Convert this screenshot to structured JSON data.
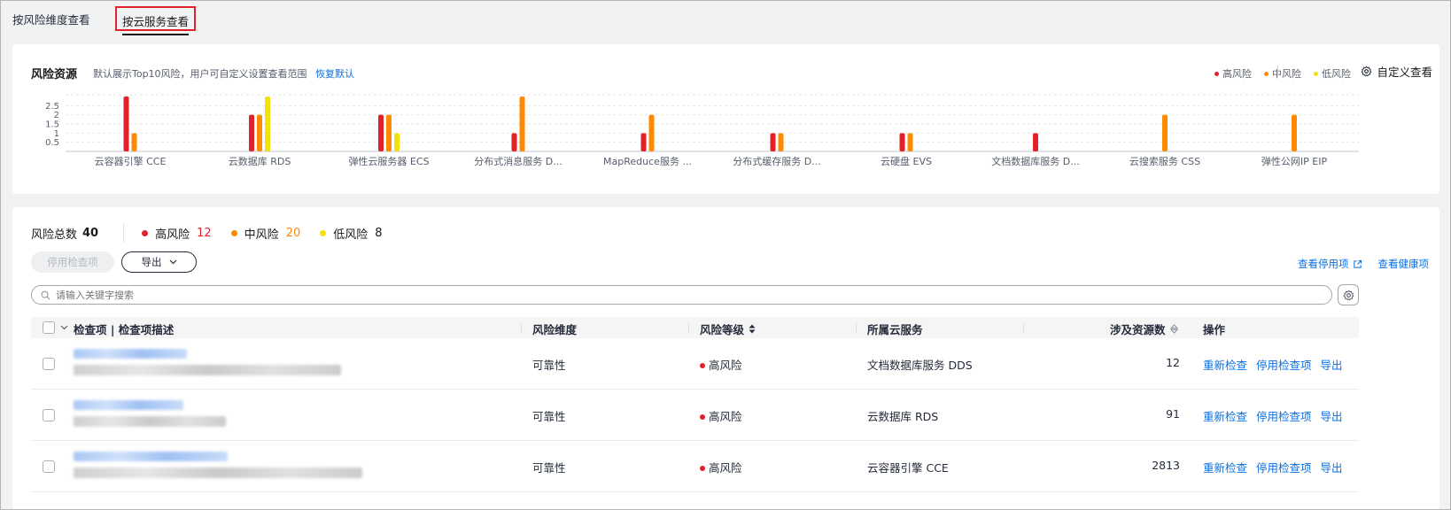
{
  "tabs": [
    {
      "label": "按风险维度查看"
    },
    {
      "label": "按云服务查看"
    }
  ],
  "risk_card": {
    "title": "风险资源",
    "subtitle": "默认展示Top10风险，用户可自定义设置查看范围",
    "restore_label": "恢复默认",
    "legend": [
      {
        "label": "高风险",
        "color": "#e1222b"
      },
      {
        "label": "中风险",
        "color": "#ff8a00"
      },
      {
        "label": "低风险",
        "color": "#f2e10c"
      }
    ],
    "custom_view_label": "自定义查看"
  },
  "chart_data": {
    "type": "bar",
    "categories": [
      "云容器引擎 CCE",
      "云数据库 RDS",
      "弹性云服务器 ECS",
      "分布式消息服务 D...",
      "MapReduce服务 ...",
      "分布式缓存服务 D...",
      "云硬盘 EVS",
      "文档数据库服务 D...",
      "云搜索服务 CSS",
      "弹性公网IP EIP"
    ],
    "series": [
      {
        "name": "高风险",
        "color": "#e1222b",
        "values": [
          3,
          2,
          2,
          1,
          1,
          1,
          1,
          1,
          0,
          0
        ]
      },
      {
        "name": "中风险",
        "color": "#ff8a00",
        "values": [
          1,
          2,
          2,
          3,
          2,
          1,
          1,
          0,
          2,
          2
        ]
      },
      {
        "name": "低风险",
        "color": "#f2e10c",
        "values": [
          0,
          3,
          1,
          0,
          0,
          0,
          0,
          0,
          0,
          0
        ]
      }
    ],
    "y_ticks": [
      "2.5",
      "2",
      "1.5",
      "1",
      "0.5"
    ],
    "ylim": [
      0,
      3
    ],
    "grid": true
  },
  "summary": {
    "total_label": "风险总数",
    "total": "40",
    "high_label": "高风险",
    "high": "12",
    "high_color": "#e1222b",
    "mid_label": "中风险",
    "mid": "20",
    "mid_color": "#ff8a00",
    "low_label": "低风险",
    "low": "8",
    "low_color": "#f2e10c"
  },
  "toolbar": {
    "disable_label": "停用检查项",
    "export_label": "导出",
    "view_disabled_label": "查看停用项",
    "view_healthy_label": "查看健康项"
  },
  "search": {
    "placeholder": "请输入关键字搜索"
  },
  "table": {
    "headers": {
      "item": "检查项 | 检查项描述",
      "dimension": "风险维度",
      "level": "风险等级",
      "service": "所属云服务",
      "resources": "涉及资源数",
      "ops": "操作"
    },
    "rows": [
      {
        "dimension": "可靠性",
        "level": "高风险",
        "service": "文档数据库服务 DDS",
        "resources": "12"
      },
      {
        "dimension": "可靠性",
        "level": "高风险",
        "service": "云数据库 RDS",
        "resources": "91"
      },
      {
        "dimension": "可靠性",
        "level": "高风险",
        "service": "云容器引擎 CCE",
        "resources": "2813"
      }
    ],
    "ops": {
      "recheck": "重新检查",
      "disable": "停用检查项",
      "export": "导出"
    }
  }
}
